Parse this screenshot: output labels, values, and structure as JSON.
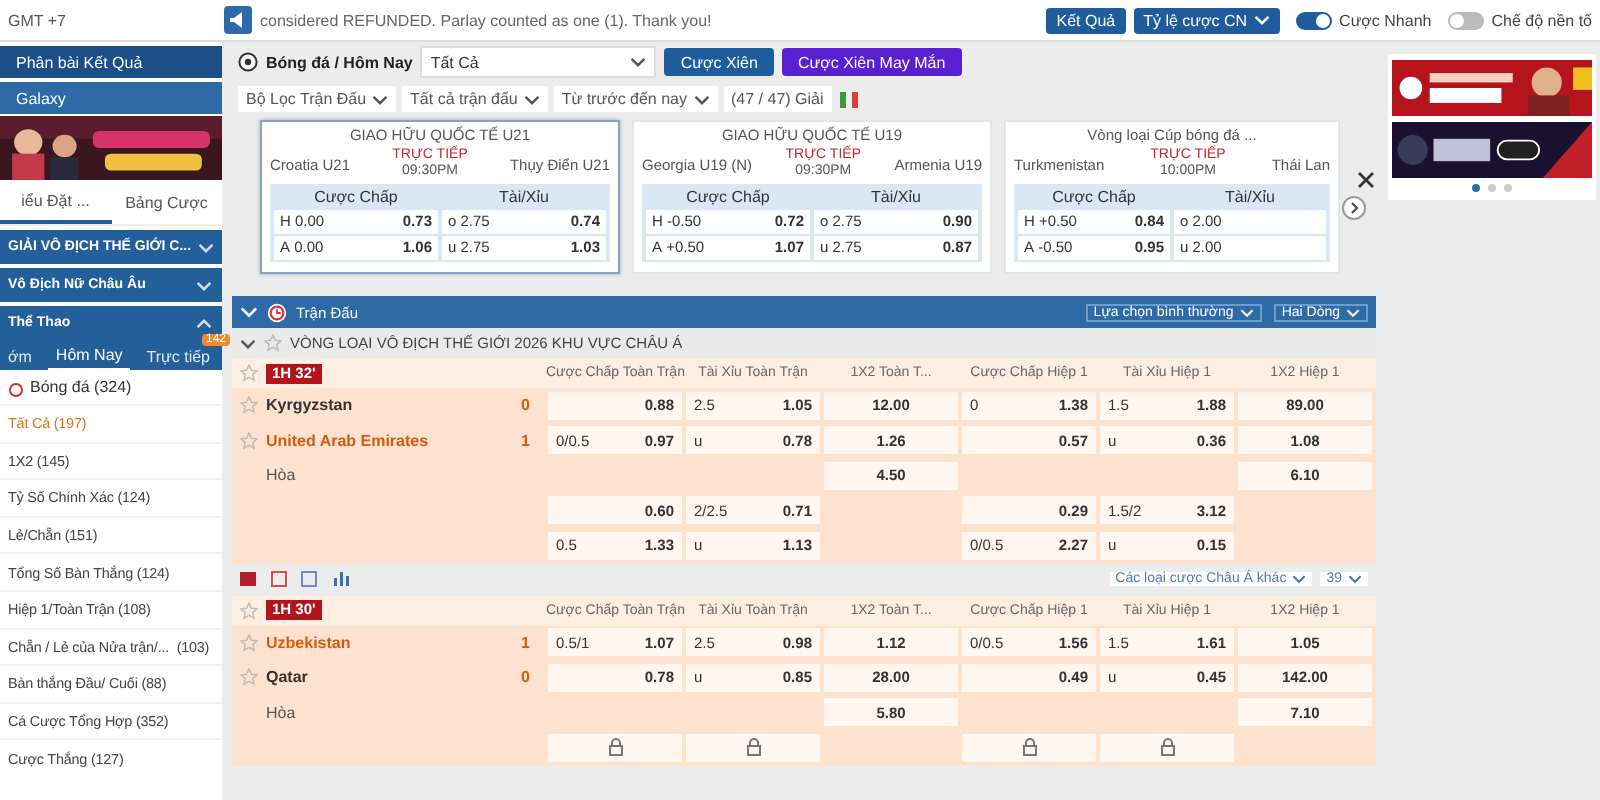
{
  "top_bar": {
    "clock": "GMT +7",
    "notice": "considered REFUNDED. Parlay counted as one (1). Thank you!",
    "buttons": [
      {
        "label": "Kết Quả",
        "dropdown": false
      },
      {
        "label": "Tỷ lệ cược CN",
        "dropdown": true
      }
    ],
    "toggles": [
      {
        "label": "Cược Nhanh",
        "on": true
      },
      {
        "label": "Chế độ nền tố",
        "on": false
      }
    ]
  },
  "sidebar": {
    "links": [
      "Phân bài Kết Quả",
      "Galaxy"
    ],
    "banner": {
      "kind": "picture"
    },
    "tabs": [
      {
        "label": "iểu Đặt ...",
        "selected": true
      },
      {
        "label": "Bảng Cược",
        "selected": false
      }
    ],
    "sections": [
      {
        "label": "GIẢI VÔ ĐỊCH THẾ GIỚI C...",
        "expanded": false
      },
      {
        "label": "Vô Địch Nữ Châu Âu",
        "expanded": false
      },
      {
        "label": "Thể Thao",
        "expanded": true
      }
    ],
    "time_tabs": [
      {
        "label": "ớm",
        "selected": false
      },
      {
        "label": "Hôm Nay",
        "selected": true
      },
      {
        "label": "Trực tiếp",
        "selected": false,
        "badge": "142"
      }
    ],
    "sport": "Bóng đá (324)",
    "markets": [
      {
        "label": "Tất Cả (197)",
        "selected": true
      },
      {
        "label": "1X2 (145)",
        "selected": false
      },
      {
        "label": "Tỷ Số Chính Xác (124)",
        "selected": false
      },
      {
        "label": "Lẻ/Chẵn (151)",
        "selected": false
      },
      {
        "label": "Tổng Số Bàn Thắng (124)",
        "selected": false
      },
      {
        "label": "Hiệp 1/Toàn Trận (108)",
        "selected": false
      },
      {
        "label": "Chẵn / Lẻ của Nửa trận/...",
        "count": "(103)",
        "selected": false
      },
      {
        "label": "Bàn thắng Đầu/ Cuối (88)",
        "selected": false
      },
      {
        "label": "Cá Cược Tổng Hợp (352)",
        "selected": false
      },
      {
        "label": "Cược Thắng (127)",
        "selected": false
      }
    ]
  },
  "toolbar": {
    "breadcrumb": "Bóng đá / Hôm Nay",
    "select": "Tất Cả",
    "buttons": [
      {
        "label": "Cược Xiên",
        "kind": "parlay"
      },
      {
        "label": "Cược Xiên May Mắn",
        "kind": "lucky"
      }
    ],
    "filters": [
      "Bộ Lọc Trận Đấu",
      "Tất cả trận đấu",
      "Từ trước đến nay"
    ],
    "league_count": "(47 / 47) Giải"
  },
  "featured": [
    {
      "league": "GIAO HỮU QUỐC TẾ U21",
      "home": "Croatia U21",
      "away": "Thụy Điển U21",
      "status": "TRỰC TIẾP",
      "time": "09:30PM",
      "selected": true,
      "hdp_label": "Cược Chấp",
      "ou_label": "Tài/Xỉu",
      "hdp": [
        {
          "side": "H",
          "line": "0.00",
          "odds": "0.73"
        },
        {
          "side": "A",
          "line": "0.00",
          "odds": "1.06"
        }
      ],
      "ou": [
        {
          "side": "o",
          "line": "2.75",
          "odds": "0.74"
        },
        {
          "side": "u",
          "line": "2.75",
          "odds": "1.03"
        }
      ]
    },
    {
      "league": "GIAO HỮU QUỐC TẾ U19",
      "home": "Georgia U19 (N)",
      "away": "Armenia U19",
      "status": "TRỰC TIẾP",
      "time": "09:30PM",
      "selected": false,
      "hdp_label": "Cược Chấp",
      "ou_label": "Tài/Xỉu",
      "hdp": [
        {
          "side": "H",
          "line": "-0.50",
          "odds": "0.72"
        },
        {
          "side": "A",
          "line": "+0.50",
          "odds": "1.07"
        }
      ],
      "ou": [
        {
          "side": "o",
          "line": "2.75",
          "odds": "0.90"
        },
        {
          "side": "u",
          "line": "2.75",
          "odds": "0.87"
        }
      ]
    },
    {
      "league": "Vòng loại Cúp bóng đá ...",
      "home": "Turkmenistan",
      "away": "Thái Lan",
      "status": "TRỰC TIẾP",
      "time": "10:00PM",
      "selected": false,
      "hdp_label": "Cược Chấp",
      "ou_label": "Tài/Xỉu",
      "hdp": [
        {
          "side": "H",
          "line": "+0.50",
          "odds": "0.84"
        },
        {
          "side": "A",
          "line": "-0.50",
          "odds": "0.95"
        }
      ],
      "ou": [
        {
          "side": "o",
          "line": "2.00"
        },
        {
          "side": "u",
          "line": "2.00"
        }
      ]
    }
  ],
  "matches_section": {
    "title": "Trận Đấu",
    "options": [
      "Lựa chọn bình thường",
      "Hai Dòng"
    ],
    "league": "VÒNG LOẠI VÔ ĐỊCH THẾ GIỚI 2026 KHU VỰC CHÂU Á",
    "matches": [
      {
        "time": "1H 32'",
        "columns": [
          "Cược Chấp Toàn Trận",
          "Tài Xỉu Toàn Trận",
          "1X2 Toàn T...",
          "Cược Chấp Hiệp 1",
          "Tài Xỉu Hiệp 1",
          "1X2 Hiệp 1"
        ],
        "rows": [
          {
            "team": "Kyrgyzstan",
            "score": "0",
            "favorite": false,
            "cells": [
              {
                "kind": "pair",
                "odds": "0.88"
              },
              {
                "kind": "pair",
                "line": "2.5",
                "odds": "1.05"
              },
              {
                "kind": "single",
                "odds": "12.00"
              },
              {
                "kind": "pair",
                "line": "0",
                "odds": "1.38"
              },
              {
                "kind": "pair",
                "line": "1.5",
                "odds": "1.88"
              },
              {
                "kind": "single",
                "odds": "89.00"
              }
            ]
          },
          {
            "team": "United Arab Emirates",
            "score": "1",
            "favorite": true,
            "cells": [
              {
                "kind": "pair",
                "line": "0/0.5",
                "odds": "0.97"
              },
              {
                "kind": "pair",
                "line": "u",
                "odds": "0.78"
              },
              {
                "kind": "single",
                "odds": "1.26"
              },
              {
                "kind": "pair",
                "odds": "0.57"
              },
              {
                "kind": "pair",
                "line": "u",
                "odds": "0.36"
              },
              {
                "kind": "single",
                "odds": "1.08"
              }
            ]
          },
          {
            "team": "Hòa",
            "cells": [
              {
                "kind": "empty"
              },
              {
                "kind": "empty"
              },
              {
                "kind": "single",
                "odds": "4.50"
              },
              {
                "kind": "empty"
              },
              {
                "kind": "empty"
              },
              {
                "kind": "single",
                "odds": "6.10"
              }
            ]
          },
          {
            "cells": [
              {
                "kind": "pair",
                "odds": "0.60"
              },
              {
                "kind": "pair",
                "line": "2/2.5",
                "odds": "0.71"
              },
              {
                "kind": "empty"
              },
              {
                "kind": "pair",
                "odds": "0.29"
              },
              {
                "kind": "pair",
                "line": "1.5/2",
                "odds": "3.12"
              },
              {
                "kind": "empty"
              }
            ]
          },
          {
            "cells": [
              {
                "kind": "pair",
                "line": "0.5",
                "odds": "1.33"
              },
              {
                "kind": "pair",
                "line": "u",
                "odds": "1.13"
              },
              {
                "kind": "empty"
              },
              {
                "kind": "pair",
                "line": "0/0.5",
                "odds": "2.27"
              },
              {
                "kind": "pair",
                "line": "u",
                "odds": "0.15"
              },
              {
                "kind": "empty"
              }
            ]
          }
        ],
        "more": "Các loại cược Châu Á khác",
        "more_count": "39"
      },
      {
        "time": "1H 30'",
        "columns": [
          "Cược Chấp Toàn Trận",
          "Tài Xỉu Toàn Trận",
          "1X2 Toàn T...",
          "Cược Chấp Hiệp 1",
          "Tài Xỉu Hiệp 1",
          "1X2 Hiệp 1"
        ],
        "rows": [
          {
            "team": "Uzbekistan",
            "score": "1",
            "favorite": true,
            "cells": [
              {
                "kind": "pair",
                "line": "0.5/1",
                "odds": "1.07"
              },
              {
                "kind": "pair",
                "line": "2.5",
                "odds": "0.98"
              },
              {
                "kind": "single",
                "odds": "1.12"
              },
              {
                "kind": "pair",
                "line": "0/0.5",
                "odds": "1.56"
              },
              {
                "kind": "pair",
                "line": "1.5",
                "odds": "1.61"
              },
              {
                "kind": "single",
                "odds": "1.05"
              }
            ]
          },
          {
            "team": "Qatar",
            "score": "0",
            "favorite": false,
            "cells": [
              {
                "kind": "pair",
                "odds": "0.78"
              },
              {
                "kind": "pair",
                "line": "u",
                "odds": "0.85"
              },
              {
                "kind": "single",
                "odds": "28.00"
              },
              {
                "kind": "pair",
                "odds": "0.49"
              },
              {
                "kind": "pair",
                "line": "u",
                "odds": "0.45"
              },
              {
                "kind": "single",
                "odds": "142.00"
              }
            ]
          },
          {
            "team": "Hòa",
            "cells": [
              {
                "kind": "empty"
              },
              {
                "kind": "empty"
              },
              {
                "kind": "single",
                "odds": "5.80"
              },
              {
                "kind": "empty"
              },
              {
                "kind": "empty"
              },
              {
                "kind": "single",
                "odds": "7.10"
              }
            ]
          },
          {
            "cells": [
              {
                "kind": "locked"
              },
              {
                "kind": "locked"
              },
              {
                "kind": "empty"
              },
              {
                "kind": "locked"
              },
              {
                "kind": "locked"
              },
              {
                "kind": "empty"
              }
            ]
          }
        ]
      }
    ]
  },
  "ads": {
    "banners": [
      {
        "kind": "picture"
      },
      {
        "kind": "picture"
      }
    ],
    "dots": [
      {
        "selected": true
      },
      {
        "selected": false
      },
      {
        "selected": false
      }
    ]
  }
}
